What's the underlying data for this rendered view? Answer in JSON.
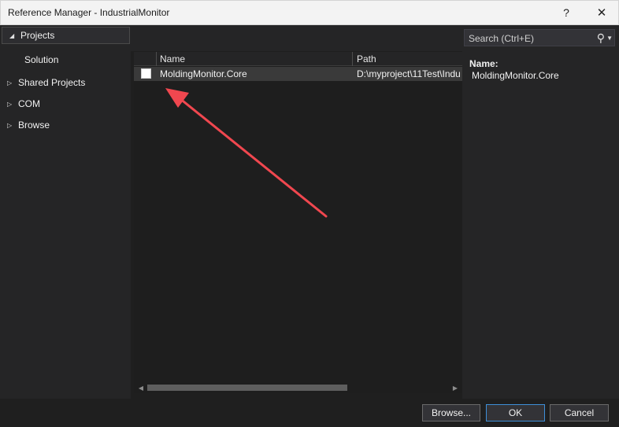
{
  "window": {
    "title": "Reference Manager - IndustrialMonitor",
    "help_glyph": "?",
    "close_glyph": "✕"
  },
  "nav": {
    "items": [
      {
        "label": "Projects",
        "arrow": "◢",
        "selected": true
      },
      {
        "label": "Solution",
        "arrow": "",
        "selected": false
      },
      {
        "label": "Shared Projects",
        "arrow": "▷",
        "selected": false
      },
      {
        "label": "COM",
        "arrow": "▷",
        "selected": false
      },
      {
        "label": "Browse",
        "arrow": "▷",
        "selected": false
      }
    ]
  },
  "list": {
    "columns": [
      "Name",
      "Path"
    ],
    "rows": [
      {
        "name": "MoldingMonitor.Core",
        "path": "D:\\myproject\\11Test\\Indu",
        "checked": false
      }
    ]
  },
  "search": {
    "placeholder": "Search (Ctrl+E)",
    "icon_glyph": "⚲",
    "dropdown_glyph": "▼"
  },
  "details": {
    "label": "Name:",
    "value": "MoldingMonitor.Core"
  },
  "buttons": {
    "browse": "Browse...",
    "ok": "OK",
    "cancel": "Cancel"
  },
  "scroll": {
    "left_glyph": "◀",
    "right_glyph": "▶"
  },
  "colors": {
    "annotation_arrow": "#f0474f",
    "ok_border": "#3e8fd8"
  }
}
